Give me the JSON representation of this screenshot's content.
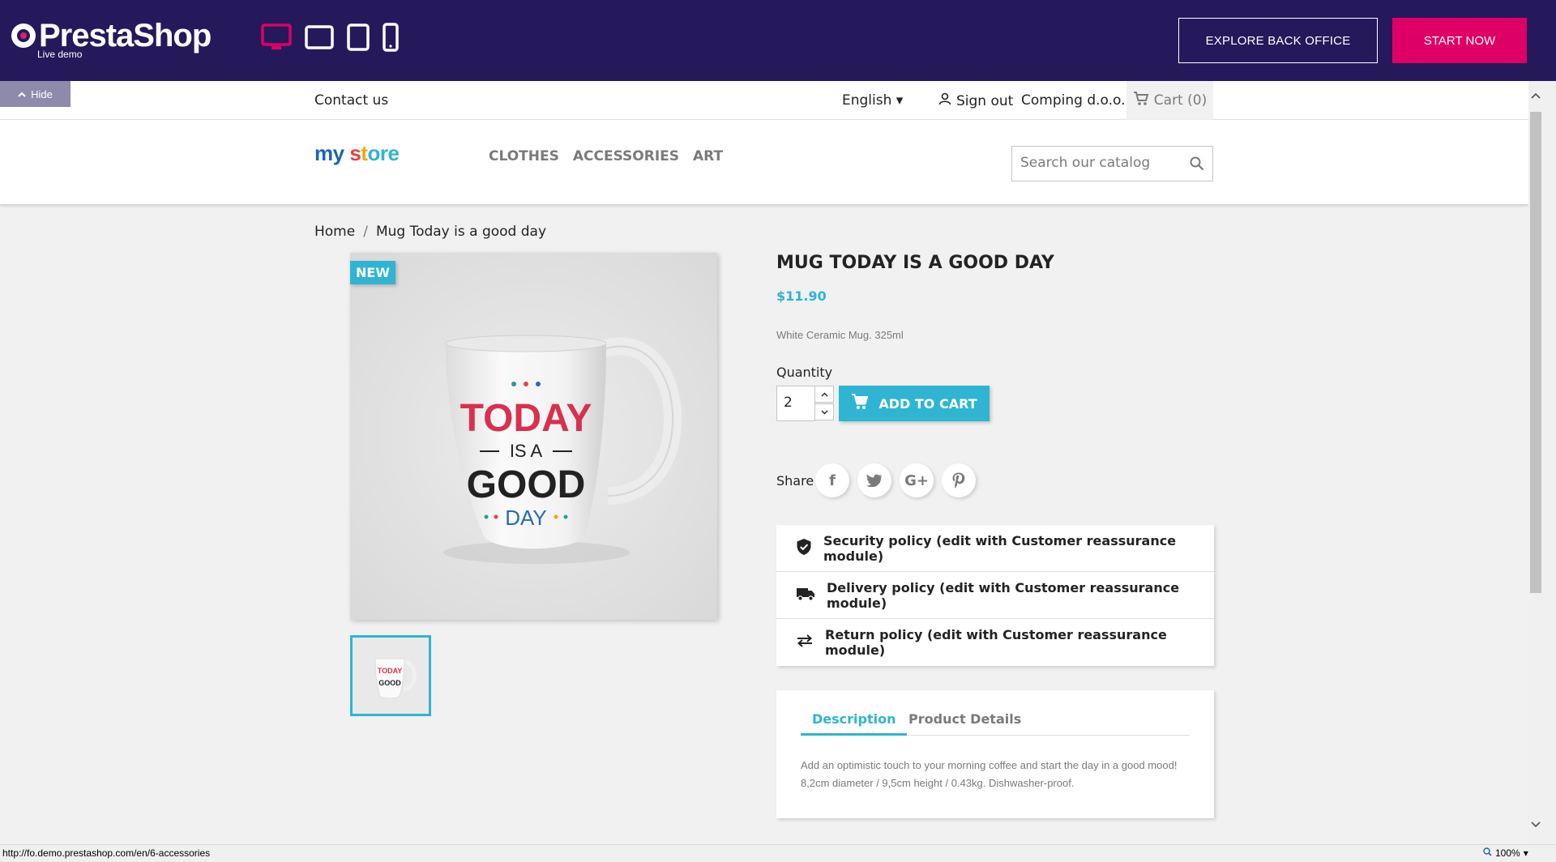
{
  "demo_bar": {
    "brand": "PrestaShop",
    "subtitle": "Live demo",
    "explore_label": "EXPLORE BACK OFFICE",
    "start_label": "START NOW",
    "hide_label": "Hide",
    "colors": {
      "bar": "#25195b",
      "accent": "#df0067"
    }
  },
  "top_nav": {
    "contact": "Contact us",
    "language": "English",
    "signout": "Sign out",
    "company": "Comping d.o.o.",
    "cart": "Cart (0)"
  },
  "header": {
    "logo": {
      "p1": "my",
      "p2": "s",
      "p3": "t",
      "p4": "ore"
    },
    "menu": [
      "CLOTHES",
      "ACCESSORIES",
      "ART"
    ],
    "search_placeholder": "Search our catalog"
  },
  "breadcrumb": {
    "home": "Home",
    "current": "Mug Today is a good day"
  },
  "product": {
    "badge": "NEW",
    "title": "MUG TODAY IS A GOOD DAY",
    "price": "$11.90",
    "short_desc": "White Ceramic Mug. 325ml",
    "qty_label": "Quantity",
    "qty_value": "2",
    "add_to_cart": "ADD TO CART",
    "share_label": "Share",
    "mug_text": {
      "line1": "TODAY",
      "line2": "IS A",
      "line3": "GOOD",
      "line4": "DAY"
    }
  },
  "reassurance": [
    {
      "icon": "shield-check-icon",
      "label": "Security policy (edit with Customer reassurance module)"
    },
    {
      "icon": "truck-icon",
      "label": "Delivery policy (edit with Customer reassurance module)"
    },
    {
      "icon": "swap-arrows-icon",
      "label": "Return policy (edit with Customer reassurance module)"
    }
  ],
  "tabs": {
    "description": "Description",
    "details": "Product Details",
    "text_line1": "Add an optimistic touch to your morning coffee and start the day in a good mood!",
    "text_line2": "8,2cm diameter / 9,5cm height / 0.43kg. Dishwasher-proof."
  },
  "statusbar": {
    "url": "http://fo.demo.prestashop.com/en/6-accessories",
    "zoom": "100%"
  },
  "colors": {
    "primary": "#2fb5d2",
    "text": "#232323",
    "muted": "#7a7a7a"
  }
}
